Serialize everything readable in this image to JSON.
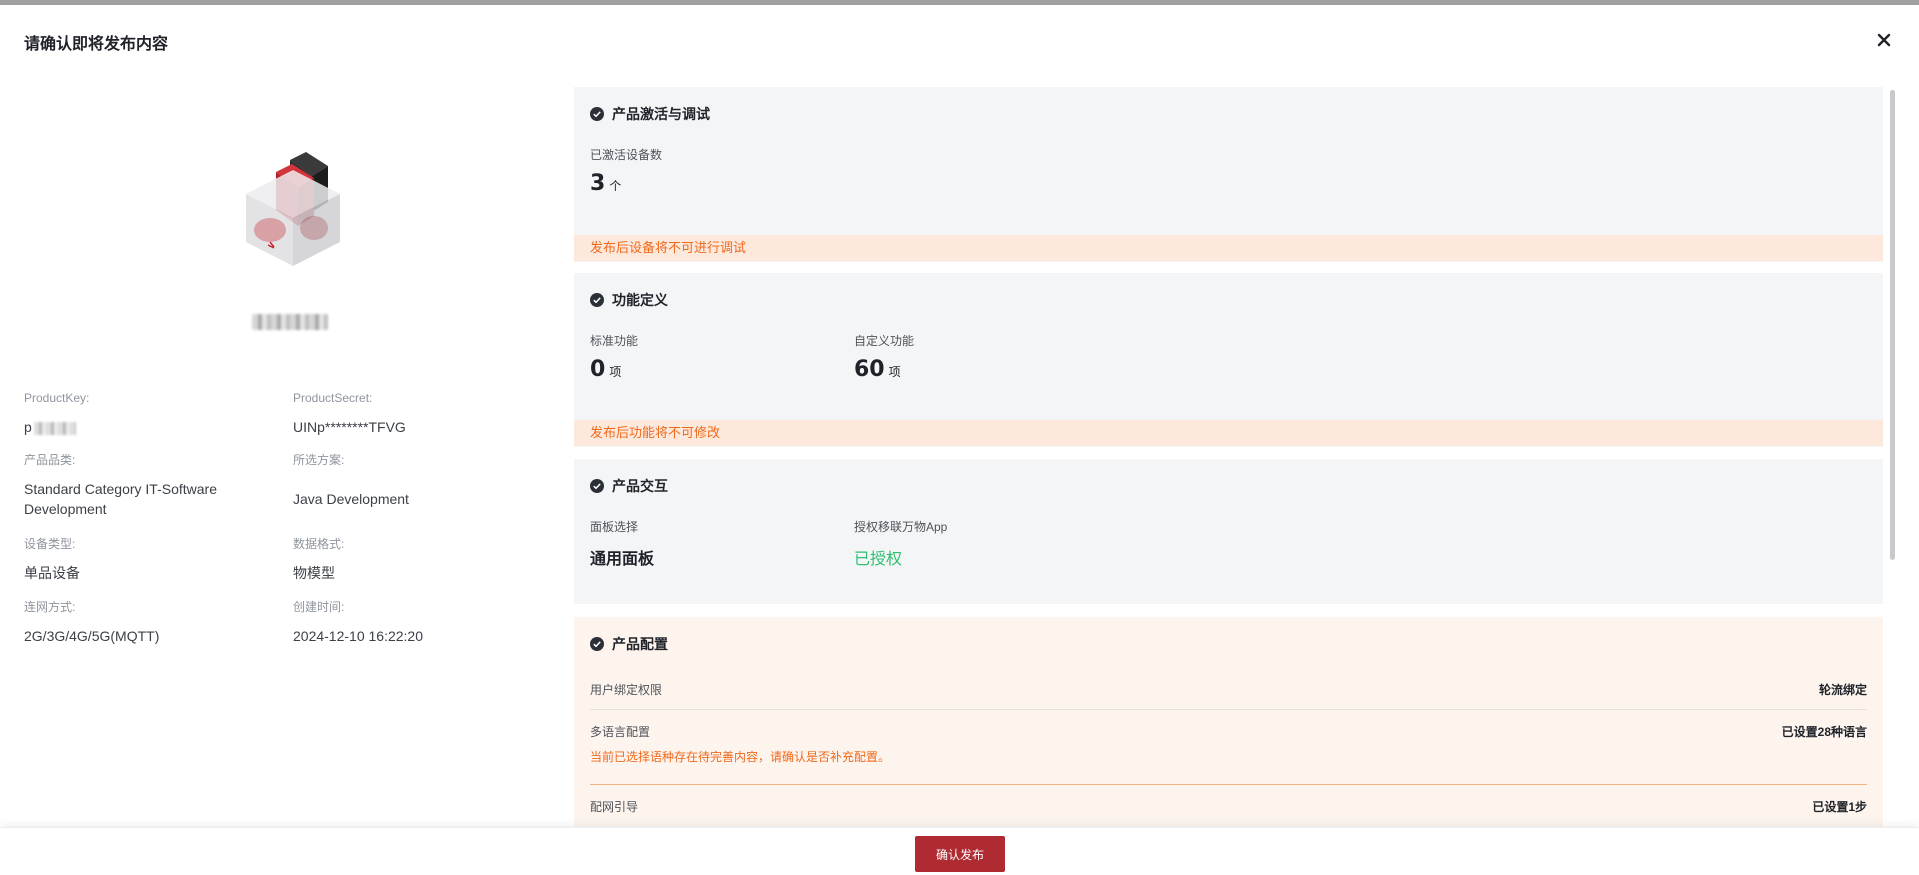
{
  "modal": {
    "title": "请确认即将发布内容"
  },
  "product": {
    "fields": [
      {
        "label": "ProductKey:",
        "value": "p"
      },
      {
        "label": "ProductSecret:",
        "value": "UINp********TFVG"
      },
      {
        "label": "产品品类:",
        "value": "Standard Category IT-Software Development"
      },
      {
        "label": "所选方案:",
        "value": "Java Development"
      },
      {
        "label": "设备类型:",
        "value": "单品设备"
      },
      {
        "label": "数据格式:",
        "value": "物模型"
      },
      {
        "label": "连网方式:",
        "value": "2G/3G/4G/5G(MQTT)"
      },
      {
        "label": "创建时间:",
        "value": "2024-12-10 16:22:20"
      }
    ]
  },
  "sections": {
    "activation": {
      "title": "产品激活与调试",
      "activated_label": "已激活设备数",
      "activated_count": "3",
      "activated_unit": "个",
      "warning": "发布后设备将不可进行调试"
    },
    "functions": {
      "title": "功能定义",
      "standard_label": "标准功能",
      "standard_count": "0",
      "standard_unit": "项",
      "custom_label": "自定义功能",
      "custom_count": "60",
      "custom_unit": "项",
      "warning": "发布后功能将不可修改"
    },
    "interaction": {
      "title": "产品交互",
      "panel_label": "面板选择",
      "panel_value": "通用面板",
      "auth_label": "授权移联万物App",
      "auth_value": "已授权"
    },
    "config": {
      "title": "产品配置",
      "rows": [
        {
          "key": "用户绑定权限",
          "value": "轮流绑定"
        },
        {
          "key": "多语言配置",
          "value": "已设置28种语言",
          "warning": "当前已选择语种存在待完善内容，请确认是否补充配置。"
        },
        {
          "key": "配网引导",
          "value": "已设置1步"
        }
      ]
    }
  },
  "footer": {
    "confirm_label": "确认发布"
  },
  "colors": {
    "primary": "#b02b31",
    "warning": "#ee6a1d",
    "success": "#2fbf71",
    "section_bg": "#f4f5f7",
    "peach_bg": "#fdf4ee"
  }
}
